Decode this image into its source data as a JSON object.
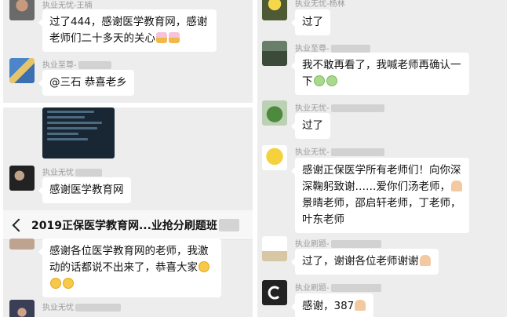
{
  "left": {
    "messages": [
      {
        "sender": "执业无忧-王楠",
        "lines": [
          "过了444，感谢医学教育网，感谢",
          "老师们二十多天的关心"
        ],
        "emoji": "popcorn-emoji"
      },
      {
        "sender": "执业至尊-",
        "lines": [
          "@三石  恭喜老乡"
        ]
      },
      {
        "image": "score-screenshot",
        "image_text": [
          "准考证号：5206151100046",
          "总成绩：407.00",
          "单元成绩：第一单元106.00 第二单元108.00 第三单元95.00",
          "第四单元98.00"
        ]
      },
      {
        "sender": "执业无忧",
        "lines": [
          "感谢医学教育网"
        ]
      }
    ],
    "header": {
      "back_icon": "chevron-left-icon",
      "title": "2019正保医学教育网...业抢分刷题班"
    },
    "after": [
      {
        "lines": [
          "感谢各位医学教育网的老师，我激",
          "动的话都说不出来了，恭喜大家"
        ],
        "emoji": "face-emoji"
      },
      {
        "sender": "执业无忧"
      }
    ]
  },
  "right": {
    "messages": [
      {
        "sender": "执业无忧-杨林",
        "lines": [
          "过了"
        ]
      },
      {
        "sender": "执业至尊-",
        "lines": [
          "我不敢再看了，我喊老师再确认一",
          "下"
        ],
        "emoji": "cry-emoji"
      },
      {
        "sender": "执业无忧-",
        "lines": [
          "过了"
        ]
      },
      {
        "sender": "执业无忧-",
        "lines": [
          "感谢正保医学所有老师们！向你深",
          "深鞠躬致谢……爱你们汤老师，",
          "景晴老师，邵启轩老师，丁老师，",
          "叶东老师"
        ]
      },
      {
        "sender": "执业刷题-",
        "lines": [
          "过了，谢谢各位老师谢谢"
        ]
      },
      {
        "sender": "执业刷题-",
        "lines": [
          "感谢，387"
        ]
      }
    ]
  },
  "colors": {
    "chat_bg": "#ededed",
    "bubble": "#ffffff",
    "sender": "#9a9a9a"
  }
}
